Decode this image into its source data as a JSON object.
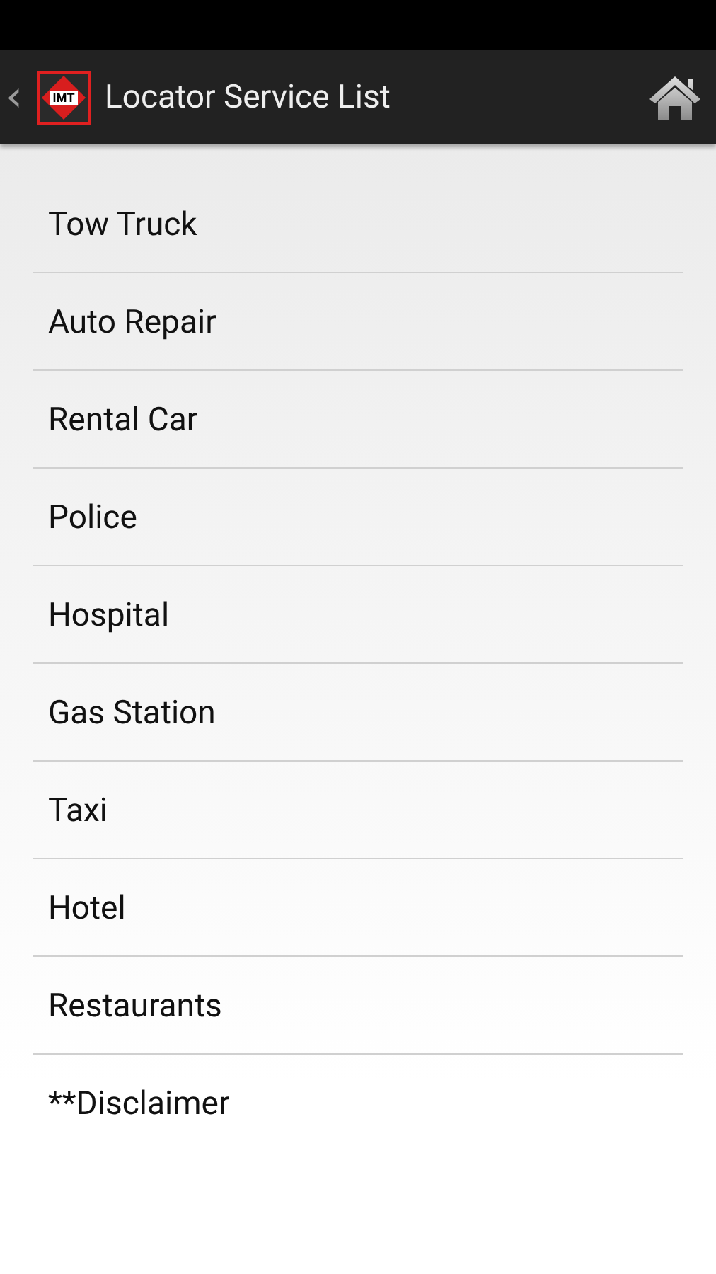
{
  "action_bar": {
    "back": "‹",
    "logo_text": "IMT",
    "title": "Locator Service List"
  },
  "services": [
    {
      "label": "Tow Truck"
    },
    {
      "label": "Auto Repair"
    },
    {
      "label": "Rental Car"
    },
    {
      "label": "Police"
    },
    {
      "label": "Hospital"
    },
    {
      "label": "Gas Station"
    },
    {
      "label": "Taxi"
    },
    {
      "label": "Hotel"
    },
    {
      "label": "Restaurants"
    },
    {
      "label": "**Disclaimer"
    }
  ]
}
